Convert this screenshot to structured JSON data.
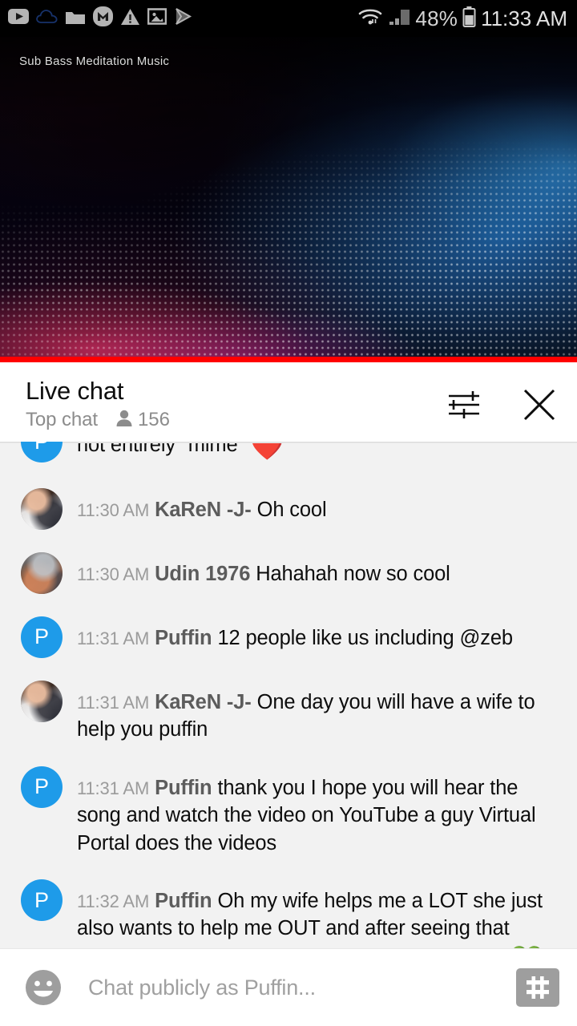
{
  "status_bar": {
    "left_icons": [
      "youtube-icon",
      "cloud-icon",
      "folder-icon",
      "mega-icon",
      "warning-icon",
      "photo-icon",
      "play-store-icon"
    ],
    "wifi_icon": "wifi-icon",
    "signal_icon": "cell-signal-icon",
    "battery_icon": "battery-icon",
    "battery_percent": "48%",
    "time": "11:33 AM"
  },
  "video": {
    "title": "Sub Bass Meditation Music",
    "progress_percent": 100,
    "progress_color": "#ff0000"
  },
  "chat_header": {
    "title": "Live chat",
    "mode": "Top chat",
    "viewer_icon": "person-icon",
    "viewer_count": "156",
    "tune_icon": "tune-icon",
    "close_icon": "close-icon"
  },
  "messages": [
    {
      "avatar_type": "letter",
      "avatar_letter": "P",
      "avatar_color": "#1e9be9",
      "time": "",
      "author": "",
      "text": "not entirely \"mime\" ",
      "emoji": "❤️",
      "partial": true
    },
    {
      "avatar_type": "photo-karen",
      "time": "11:30 AM",
      "author": "KaReN -J-",
      "text": "Oh cool",
      "emoji": ""
    },
    {
      "avatar_type": "photo-udin",
      "time": "11:30 AM",
      "author": "Udin 1976",
      "text": "Hahahah now so cool",
      "emoji": ""
    },
    {
      "avatar_type": "letter",
      "avatar_letter": "P",
      "avatar_color": "#1e9be9",
      "time": "11:31 AM",
      "author": "Puffin",
      "text": "12 people like us including @zeb",
      "emoji": ""
    },
    {
      "avatar_type": "photo-karen",
      "time": "11:31 AM",
      "author": "KaReN -J-",
      "text": "One day you will have a wife to help you puffin",
      "emoji": ""
    },
    {
      "avatar_type": "letter",
      "avatar_letter": "P",
      "avatar_color": "#1e9be9",
      "time": "11:31 AM",
      "author": "Puffin",
      "text": "thank you I hope you will hear the song and watch the video on YouTube a guy Virtual Portal does the videos",
      "emoji": ""
    },
    {
      "avatar_type": "letter",
      "avatar_letter": "P",
      "avatar_color": "#1e9be9",
      "time": "11:32 AM",
      "author": "Puffin",
      "text": "Oh my wife helps me a LOT she just also wants to help me OUT and after seeing that Gaga video I kinda hope again she will steal me ",
      "emoji": "💚"
    }
  ],
  "input_bar": {
    "emoji_icon": "emoji-smile-icon",
    "placeholder": "Chat publicly as Puffin...",
    "superchat_icon": "dollar-icon"
  }
}
